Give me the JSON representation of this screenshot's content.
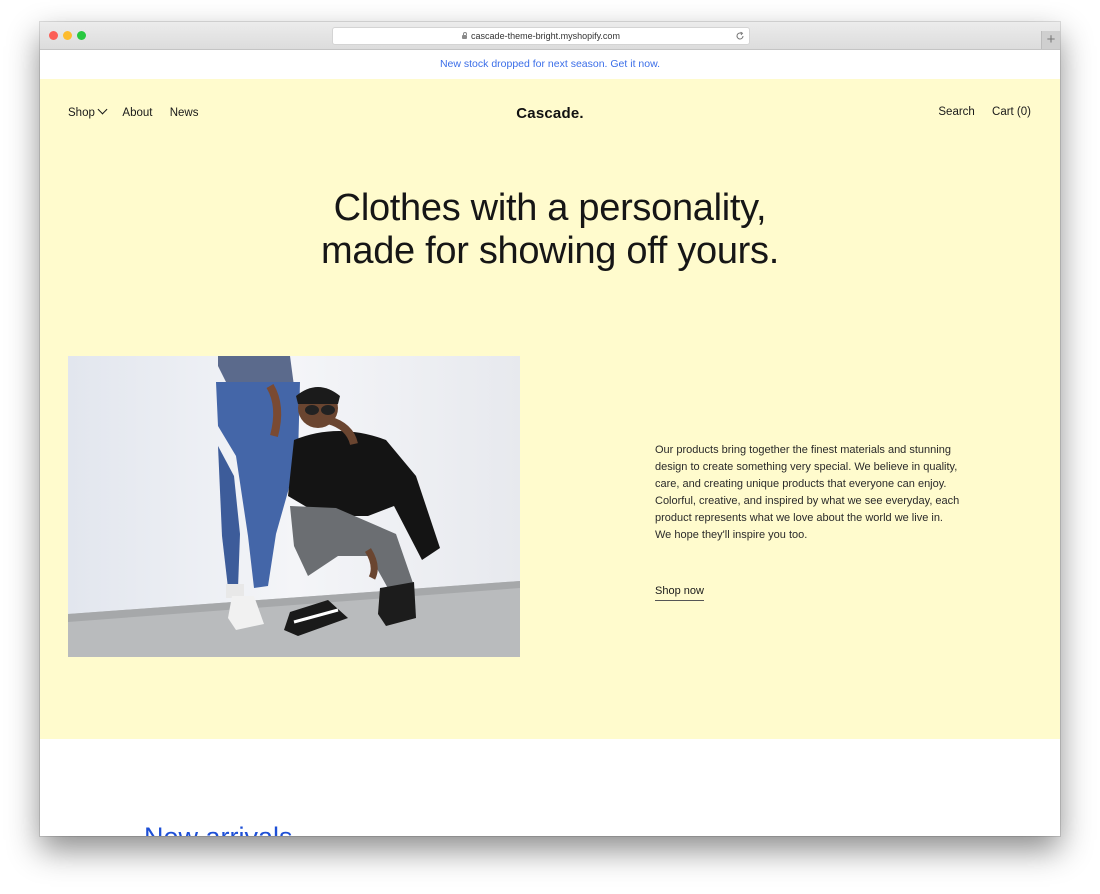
{
  "browser": {
    "url": "cascade-theme-bright.myshopify.com"
  },
  "announcement": {
    "text": "New stock dropped for next season. Get it now."
  },
  "header": {
    "nav_left": [
      "Shop",
      "About",
      "News"
    ],
    "logo": "Cascade.",
    "nav_right": [
      "Search",
      "Cart (0)"
    ]
  },
  "hero": {
    "headline_line1": "Clothes with a personality,",
    "headline_line2": "made for showing off yours.",
    "description": "Our products bring together the finest materials and stunning design to create something very special. We believe in quality, care, and creating unique products that everyone can enjoy. Colorful, creative, and inspired by what we see everyday, each product represents what we love about the world we live in. We hope they'll inspire you too.",
    "cta": "Shop now"
  },
  "sections": {
    "new_arrivals_title": "New arrivals"
  },
  "colors": {
    "hero_background": "#fffbcd",
    "link_blue": "#3b6ee8",
    "heading_blue": "#1d4fd6",
    "text_dark": "#161616"
  },
  "icons": {
    "lock": "lock-icon",
    "reload": "reload-icon",
    "dropdown": "chevron-down-icon"
  }
}
